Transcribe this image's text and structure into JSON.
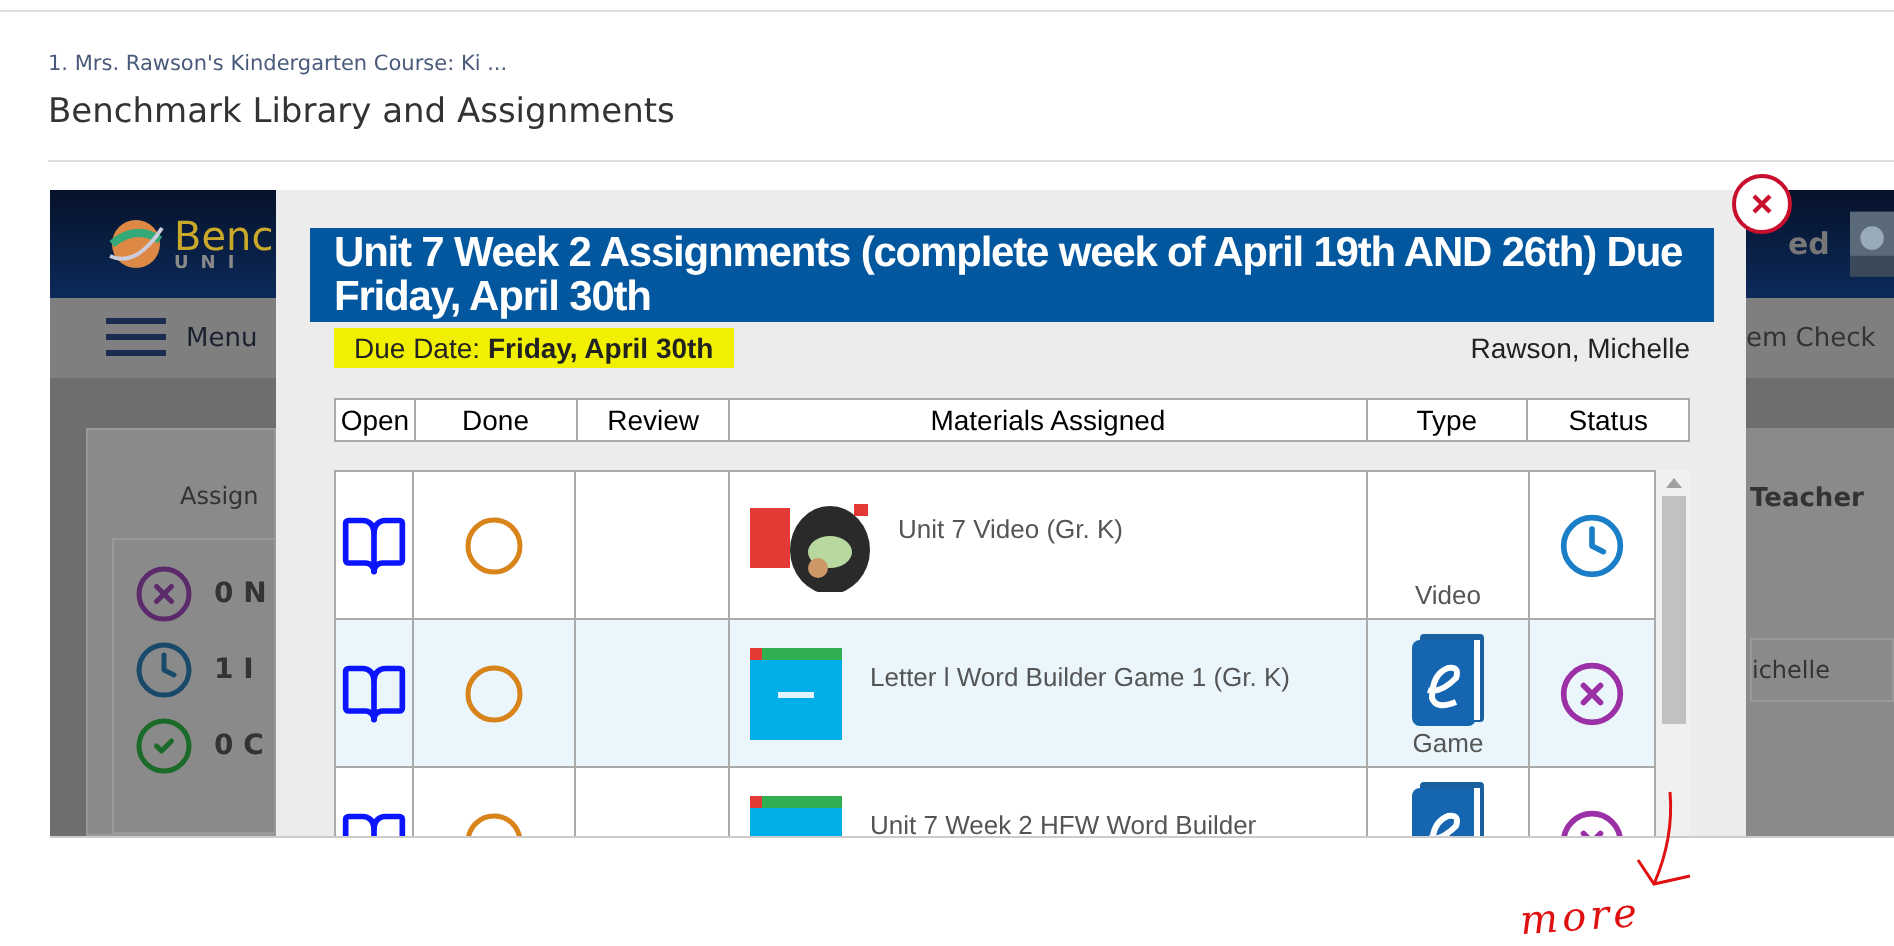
{
  "breadcrumb": "1. Mrs. Rawson's Kindergarten Course: Ki ...",
  "page_title": "Benchmark Library and Assignments",
  "background_app": {
    "logo_line_1": "Benc",
    "logo_line_2": "UNI",
    "menu_label": "Menu",
    "panel_title": "Assign",
    "status_counts": [
      {
        "kind": "not_started",
        "text": "0 N"
      },
      {
        "kind": "in_progress",
        "text": "1 I"
      },
      {
        "kind": "complete",
        "text": "0 C"
      }
    ],
    "right_header_text": "ed",
    "right_menu_text": "em Check",
    "right_heading": "Teacher",
    "right_field_value": "ichelle"
  },
  "dialog": {
    "title": "Unit 7 Week 2 Assignments (complete week of April 19th AND 26th) Due Friday, April 30th",
    "due_label": "Due Date:",
    "due_value": "Friday, April 30th",
    "student": "Rawson, Michelle",
    "columns": [
      "Open",
      "Done",
      "Review",
      "Materials Assigned",
      "Type",
      "Status"
    ],
    "rows": [
      {
        "material": "Unit 7 Video (Gr. K)",
        "kind": "video",
        "type": "Video",
        "done": false,
        "status": {
          "kind": "in_progress"
        },
        "highlighted": false
      },
      {
        "material": "Letter l Word Builder Game 1 (Gr. K)",
        "kind": "game",
        "type": "Game",
        "done": false,
        "status": {
          "kind": "not_started"
        },
        "highlighted": true
      },
      {
        "material": "Unit 7 Week 2 HFW Word Builder",
        "kind": "game",
        "done": false,
        "status": {
          "kind": "not_started"
        },
        "highlighted": false
      }
    ]
  },
  "annotation": {
    "text": "more"
  }
}
